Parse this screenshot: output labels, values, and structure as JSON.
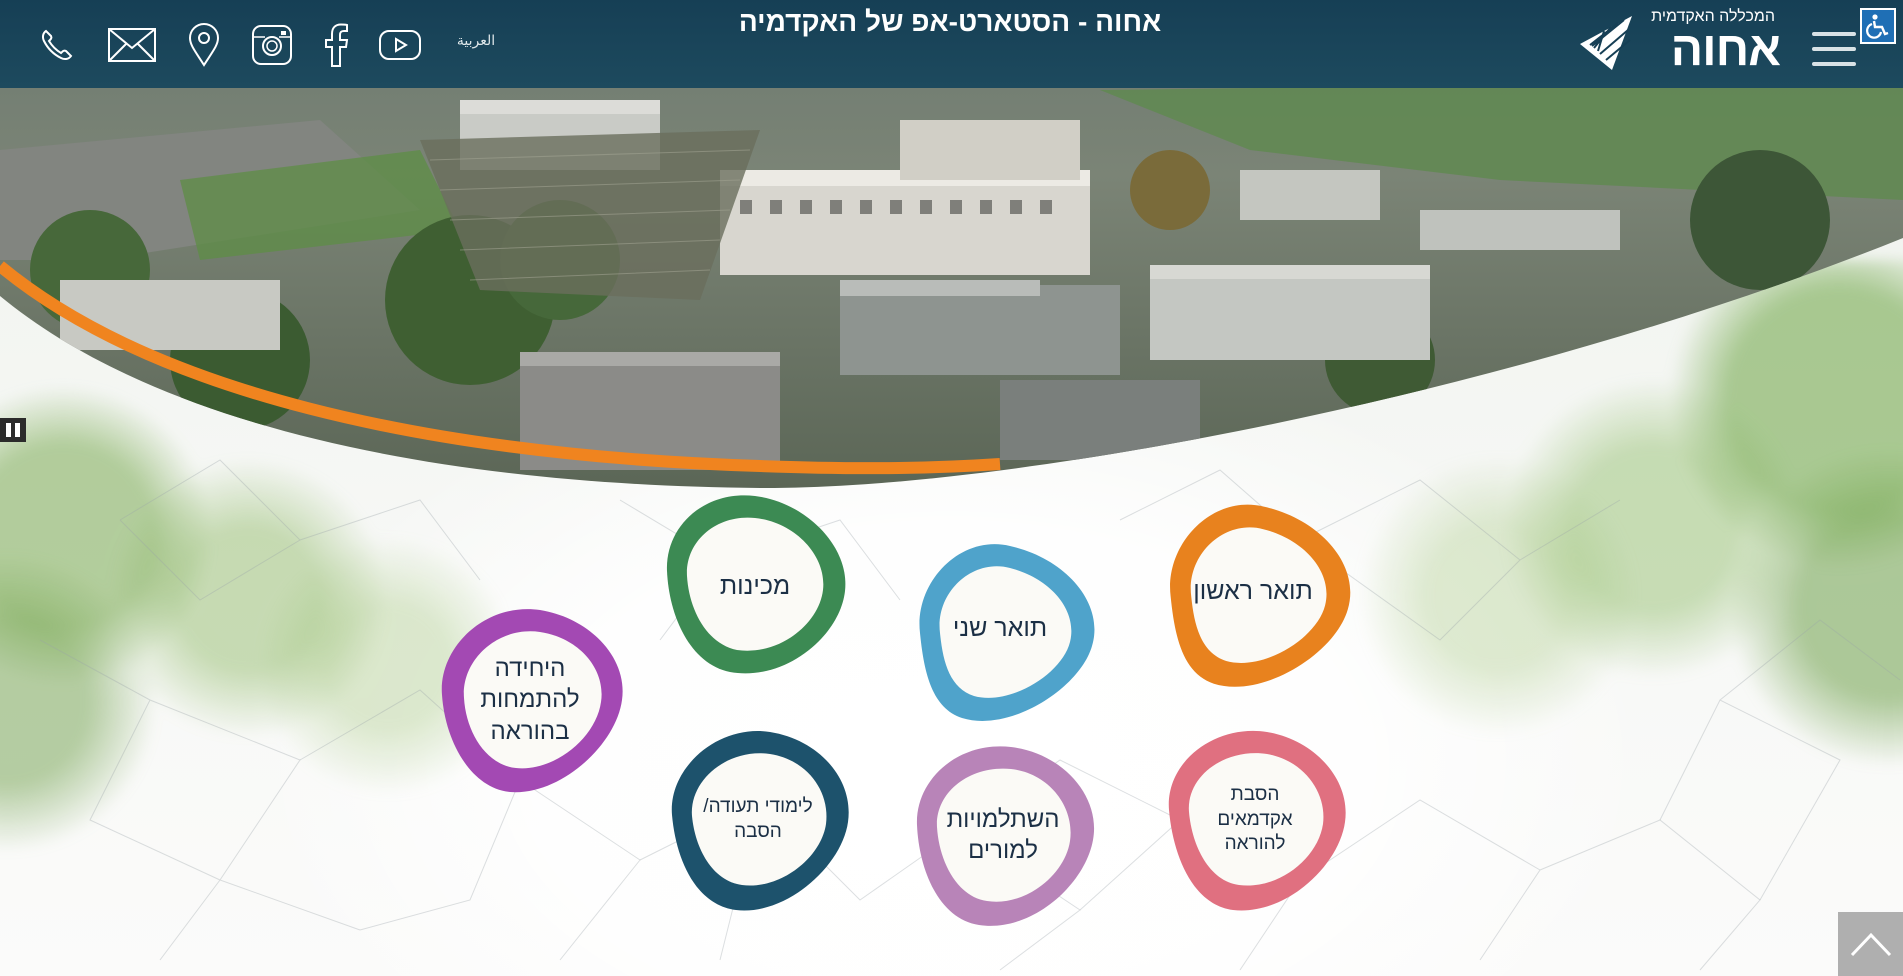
{
  "header": {
    "site_title": "אחוה - הסטארט-אפ של האקדמיה",
    "language_link": "العربية",
    "logo": {
      "subtitle": "המכללה האקדמית",
      "name": "אחוה"
    },
    "social_icons": [
      "phone-icon",
      "mail-icon",
      "location-pin-icon",
      "instagram-icon",
      "facebook-icon",
      "youtube-icon"
    ],
    "menu_icon": "hamburger-icon",
    "accessibility_icon": "wheelchair-icon"
  },
  "hero": {
    "media": "aerial-campus-video",
    "pause_icon": "pause-icon",
    "accent_color": "#f0841f"
  },
  "programs": [
    {
      "id": "first-degree",
      "label": "תואר ראשון",
      "color": "#e8821e"
    },
    {
      "id": "second-degree",
      "label": "תואר שני",
      "color": "#4fa3cb"
    },
    {
      "id": "preparatory",
      "label": "מכינות",
      "color": "#3c8a53"
    },
    {
      "id": "teaching-specialization",
      "label": "היחידה להתמחות בהוראה",
      "color": "#a349b3"
    },
    {
      "id": "academic-retraining",
      "label": "הסבת אקדמאים להוראה",
      "color": "#e07080"
    },
    {
      "id": "teacher-development",
      "label": "השתלמויות למורים",
      "color": "#b884b8"
    },
    {
      "id": "certificate-studies",
      "label": "לימודי תעודה/ הסבה",
      "color": "#1d526c"
    }
  ],
  "scroll_top_icon": "chevron-up-icon"
}
